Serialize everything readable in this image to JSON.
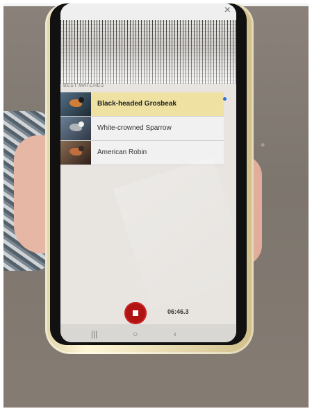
{
  "app": {
    "close_icon": "×",
    "section_label": "BEST MATCHES",
    "timer": "06:46.3"
  },
  "matches": [
    {
      "name": "Black-headed Grosbeak",
      "selected": true
    },
    {
      "name": "White-crowned Sparrow",
      "selected": false
    },
    {
      "name": "American Robin",
      "selected": false
    }
  ],
  "icons": {
    "close": "close-icon",
    "stop": "stop-icon",
    "recent_apps": "recent-apps-icon",
    "home": "home-icon",
    "back": "back-icon"
  },
  "navigation": {
    "recents": "|||",
    "home": "○",
    "back": "‹"
  },
  "colors": {
    "selected_row": "#efe1a2",
    "record_button": "#b11212",
    "status_dot": "#2f6fd3"
  }
}
